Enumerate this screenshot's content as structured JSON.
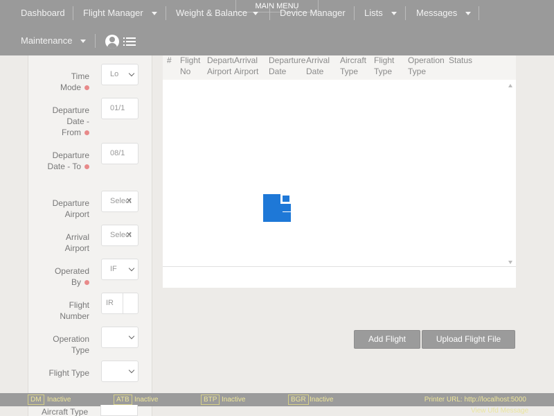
{
  "nav": {
    "main_menu": "MAIN MENU",
    "items": [
      {
        "label": "Dashboard",
        "dropdown": false
      },
      {
        "label": "Flight Manager",
        "dropdown": true
      },
      {
        "label": "Weight & Balance",
        "dropdown": true
      },
      {
        "label": "Device Manager",
        "dropdown": false
      },
      {
        "label": "Lists",
        "dropdown": true
      },
      {
        "label": "Messages",
        "dropdown": true
      },
      {
        "label": "Maintenance",
        "dropdown": true
      }
    ],
    "icons": [
      "user-icon",
      "list-icon"
    ]
  },
  "filters": {
    "time_mode": {
      "label": "Time Mode",
      "value": "Lo",
      "required": true
    },
    "departure_from": {
      "label": "Departure Date - From",
      "value": "01/1",
      "required": true
    },
    "departure_to": {
      "label": "Departure Date - To",
      "value": "08/1",
      "required": true
    },
    "departure_airport": {
      "label": "Departure Airport",
      "value": "Select"
    },
    "arrival_airport": {
      "label": "Arrival Airport",
      "value": "Select"
    },
    "operated_by": {
      "label": "Operated By",
      "value": "IF",
      "required": true
    },
    "flight_number": {
      "label": "Flight Number",
      "prefix": "IR"
    },
    "operation_type": {
      "label": "Operation Type",
      "value": ""
    },
    "flight_type": {
      "label": "Flight Type",
      "value": ""
    },
    "aircraft_type": {
      "label": "Aircraft Type",
      "value": ""
    }
  },
  "table": {
    "columns": [
      "#",
      "Flight No",
      "Departure Airport",
      "Arrival Airport",
      "Departure Date",
      "Arrival Date",
      "Aircraft Type",
      "Flight Type",
      "Operation Type",
      "Status"
    ],
    "rows": []
  },
  "buttons": {
    "add_flight": "Add Flight",
    "upload_flight_file": "Upload Flight File"
  },
  "statusbar": {
    "devices": [
      {
        "code": "DM",
        "status": "Inactive"
      },
      {
        "code": "ATB",
        "status": "Inactive"
      },
      {
        "code": "BTP",
        "status": "Inactive"
      },
      {
        "code": "BGR",
        "status": "Inactive"
      }
    ],
    "printer_url_label": "Printer URL:",
    "printer_url": "http://localhost:5000",
    "view_message": "View Ufd Message"
  },
  "colors": {
    "topbar": "#9a9a9a",
    "spinner": "#1e78d7",
    "status_text": "#efe79a",
    "required_dot": "#e88a8a"
  }
}
